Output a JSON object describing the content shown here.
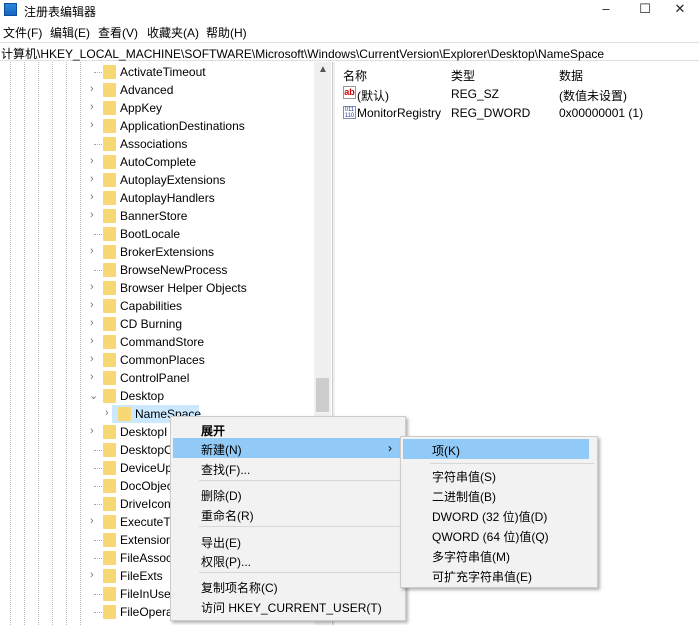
{
  "window": {
    "title": "注册表编辑器",
    "minimize": "–",
    "maximize": "☐",
    "close": "✕"
  },
  "menubar": [
    "文件(F)",
    "编辑(E)",
    "查看(V)",
    "收藏夹(A)",
    "帮助(H)"
  ],
  "address": "计算机\\HKEY_LOCAL_MACHINE\\SOFTWARE\\Microsoft\\Windows\\CurrentVersion\\Explorer\\Desktop\\NameSpace",
  "tree": [
    {
      "label": "ActivateTimeout",
      "exp": false
    },
    {
      "label": "Advanced",
      "exp": true
    },
    {
      "label": "AppKey",
      "exp": true
    },
    {
      "label": "ApplicationDestinations",
      "exp": true
    },
    {
      "label": "Associations",
      "exp": false
    },
    {
      "label": "AutoComplete",
      "exp": true
    },
    {
      "label": "AutoplayExtensions",
      "exp": true
    },
    {
      "label": "AutoplayHandlers",
      "exp": true
    },
    {
      "label": "BannerStore",
      "exp": true
    },
    {
      "label": "BootLocale",
      "exp": false
    },
    {
      "label": "BrokerExtensions",
      "exp": true
    },
    {
      "label": "BrowseNewProcess",
      "exp": false
    },
    {
      "label": "Browser Helper Objects",
      "exp": true
    },
    {
      "label": "Capabilities",
      "exp": true
    },
    {
      "label": "CD Burning",
      "exp": true
    },
    {
      "label": "CommandStore",
      "exp": true
    },
    {
      "label": "CommonPlaces",
      "exp": true
    },
    {
      "label": "ControlPanel",
      "exp": true
    },
    {
      "label": "Desktop",
      "exp": "open"
    },
    {
      "label": "NameSpace",
      "exp": true,
      "child": true,
      "selected": true
    },
    {
      "label": "DesktopI",
      "exp": true
    },
    {
      "label": "DesktopO",
      "exp": false
    },
    {
      "label": "DeviceUp",
      "exp": false
    },
    {
      "label": "DocObjec",
      "exp": false
    },
    {
      "label": "DriveIcon",
      "exp": false
    },
    {
      "label": "ExecuteTy",
      "exp": true
    },
    {
      "label": "Extension",
      "exp": false
    },
    {
      "label": "FileAssoci",
      "exp": false
    },
    {
      "label": "FileExts",
      "exp": true
    },
    {
      "label": "FileInUse",
      "exp": false
    },
    {
      "label": "FileOpera",
      "exp": false
    }
  ],
  "list": {
    "headers": [
      "名称",
      "类型",
      "数据"
    ],
    "rows": [
      {
        "name": "(默认)",
        "type": "REG_SZ",
        "data": "(数值未设置)",
        "icon": "ab"
      },
      {
        "name": "MonitorRegistry",
        "type": "REG_DWORD",
        "data": "0x00000001 (1)",
        "icon": "011\n110"
      }
    ]
  },
  "context_menu": {
    "items": [
      "展开",
      "新建(N)",
      "查找(F)...",
      "删除(D)",
      "重命名(R)",
      "导出(E)",
      "权限(P)...",
      "复制项名称(C)",
      "访问 HKEY_CURRENT_USER(T)"
    ],
    "arrow": "›"
  },
  "submenu": {
    "items": [
      "项(K)",
      "字符串值(S)",
      "二进制值(B)",
      "DWORD (32 位)值(D)",
      "QWORD (64 位)值(Q)",
      "多字符串值(M)",
      "可扩充字符串值(E)"
    ]
  }
}
